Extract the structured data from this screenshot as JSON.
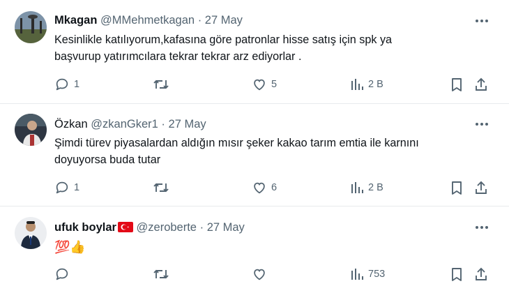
{
  "tweets": [
    {
      "name": "Mkagan",
      "handle": "@MMehmetkagan",
      "separator": "·",
      "date": "27 May",
      "lines": [
        "Kesinlikle katılıyorum,kafasına göre patronlar hisse satış için spk ya",
        "başvurup  yatırımcılara tekrar tekrar arz ediyorlar ."
      ],
      "replies": "1",
      "retweets": "",
      "likes": "5",
      "views": "2 B",
      "avatar_colors": {
        "sky": "#6a7f94",
        "ground": "#4f5d3a"
      }
    },
    {
      "name": "Özkan",
      "handle": "@zkanGker1",
      "separator": "·",
      "date": "27 May",
      "lines": [
        "Şimdi türev piyasalardan aldığın mısır şeker kakao tarım emtia ile karnını",
        "doyuyorsa buda tutar"
      ],
      "replies": "1",
      "retweets": "",
      "likes": "6",
      "views": "2 B",
      "avatar_colors": {
        "bg": "#2c3440",
        "face": "#c9a68b"
      }
    },
    {
      "name": "ufuk boylar",
      "handle": "@zeroberte",
      "separator": "·",
      "date": "27 May",
      "lines": [
        "💯👍"
      ],
      "replies": "",
      "retweets": "",
      "likes": "",
      "views": "753",
      "avatar_colors": {
        "bg": "#e9ebee",
        "suit": "#1d2a3e"
      }
    }
  ],
  "colors": {
    "text": "#0f1419",
    "muted": "#536471",
    "divider": "#e8ebed",
    "flag": "#e30a17"
  }
}
